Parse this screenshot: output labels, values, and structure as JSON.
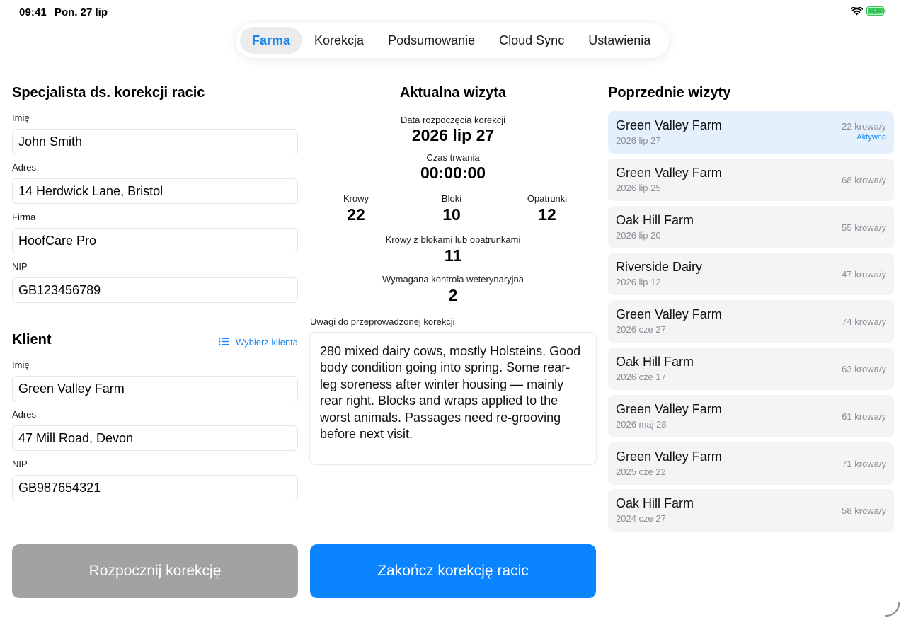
{
  "status_bar": {
    "time": "09:41",
    "date": "Pon. 27 lip"
  },
  "tabs": [
    {
      "label": "Farma",
      "active": true
    },
    {
      "label": "Korekcja",
      "active": false
    },
    {
      "label": "Podsumowanie",
      "active": false
    },
    {
      "label": "Cloud Sync",
      "active": false
    },
    {
      "label": "Ustawienia",
      "active": false
    }
  ],
  "trimmer": {
    "title": "Specjalista ds. korekcji racic",
    "name_label": "Imię",
    "name": "John Smith",
    "address_label": "Adres",
    "address": "14 Herdwick Lane, Bristol",
    "company_label": "Firma",
    "company": "HoofCare Pro",
    "vat_label": "NIP",
    "vat": "GB123456789"
  },
  "client": {
    "title": "Klient",
    "pick_label": "Wybierz klienta",
    "name_label": "Imię",
    "name": "Green Valley Farm",
    "address_label": "Adres",
    "address": "47 Mill Road, Devon",
    "vat_label": "NIP",
    "vat": "GB987654321"
  },
  "current_visit": {
    "title": "Aktualna wizyta",
    "start_label": "Data rozpoczęcia korekcji",
    "start_value": "2026 lip 27",
    "duration_label": "Czas trwania",
    "duration_value": "00:00:00",
    "cows_label": "Krowy",
    "cows_value": "22",
    "blocks_label": "Bloki",
    "blocks_value": "10",
    "wraps_label": "Opatrunki",
    "wraps_value": "12",
    "treated_label": "Krowy z blokami lub opatrunkami",
    "treated_value": "11",
    "vet_label": "Wymagana kontrola weterynaryjna",
    "vet_value": "2",
    "notes_label": "Uwagi do przeprowadzonej korekcji",
    "notes": "280 mixed dairy cows, mostly Holsteins. Good body condition going into spring. Some rear-leg soreness after winter housing — mainly rear right. Blocks and wraps applied to the worst animals. Passages need re-grooving before next visit."
  },
  "previous": {
    "title": "Poprzednie wizyty",
    "visits": [
      {
        "name": "Green Valley Farm",
        "date": "2026 lip 27",
        "count": "22 krowa/y",
        "status": "Aktywna",
        "active": true
      },
      {
        "name": "Green Valley Farm",
        "date": "2026 lip 25",
        "count": "68 krowa/y",
        "status": "",
        "active": false
      },
      {
        "name": "Oak Hill Farm",
        "date": "2026 lip 20",
        "count": "55 krowa/y",
        "status": "",
        "active": false
      },
      {
        "name": "Riverside Dairy",
        "date": "2026 lip 12",
        "count": "47 krowa/y",
        "status": "",
        "active": false
      },
      {
        "name": "Green Valley Farm",
        "date": "2026 cze 27",
        "count": "74 krowa/y",
        "status": "",
        "active": false
      },
      {
        "name": "Oak Hill Farm",
        "date": "2026 cze 17",
        "count": "63 krowa/y",
        "status": "",
        "active": false
      },
      {
        "name": "Green Valley Farm",
        "date": "2026 maj 28",
        "count": "61 krowa/y",
        "status": "",
        "active": false
      },
      {
        "name": "Green Valley Farm",
        "date": "2025 cze 22",
        "count": "71 krowa/y",
        "status": "",
        "active": false
      },
      {
        "name": "Oak Hill Farm",
        "date": "2024 cze 27",
        "count": "58 krowa/y",
        "status": "",
        "active": false
      }
    ]
  },
  "actions": {
    "start_label": "Rozpocznij korekcję",
    "finish_label": "Zakończ korekcję racic"
  },
  "colors": {
    "accent": "#0a84ff",
    "link": "#1a86ec",
    "disabled": "#a2a2a2",
    "active_row": "#e4f1fd",
    "battery": "#34c759"
  },
  "icons": {
    "wifi": "wifi-icon",
    "battery": "battery-charging-icon",
    "list": "list-icon"
  }
}
